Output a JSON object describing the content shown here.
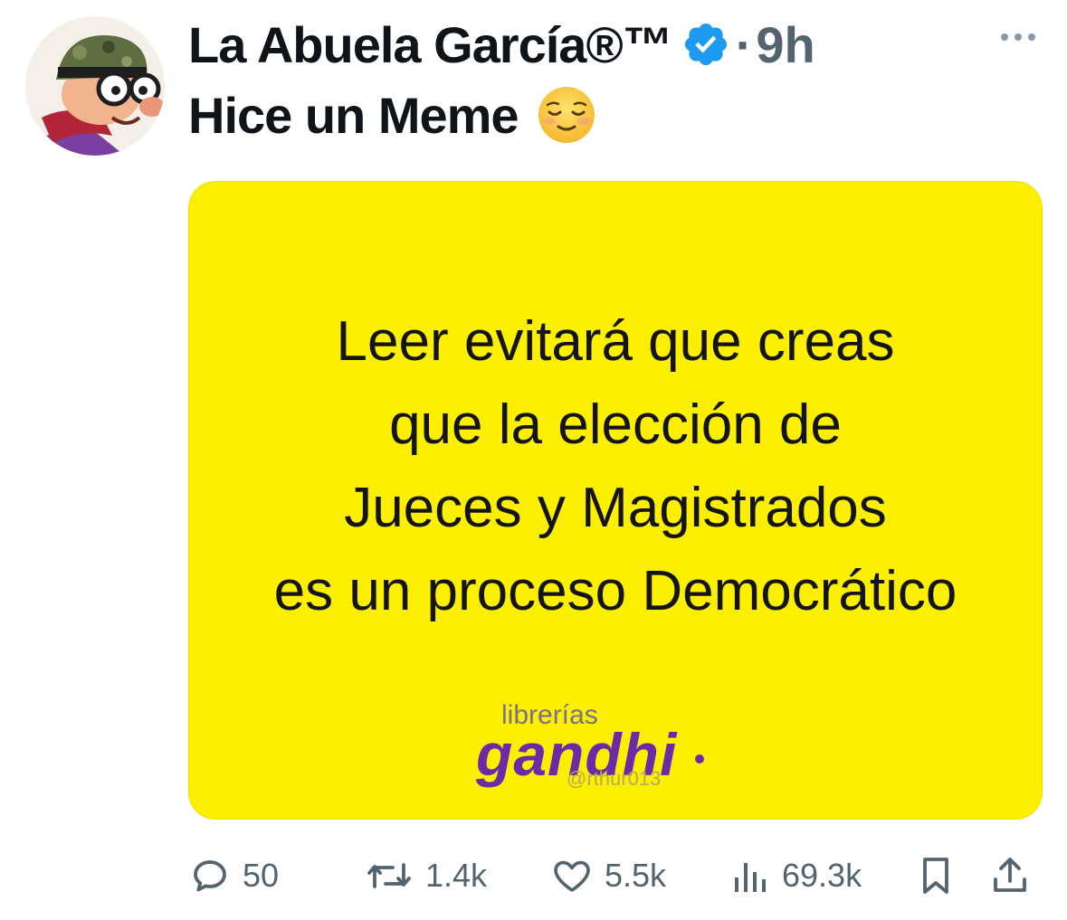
{
  "tweet": {
    "display_name": "La Abuela García®™",
    "separator": "·",
    "time": "9h",
    "text": "Hice un Meme",
    "emoji": "relieved-face-emoji",
    "verified_color": "#1d9bf0"
  },
  "media": {
    "background": "#fdef00",
    "lines": [
      "Leer evitará que creas",
      "que la elección de",
      "Jueces y Magistrados",
      "es un proceso Democrático"
    ],
    "logo_small": "librerías",
    "logo_big": "gandhi",
    "watermark": "@rthur013"
  },
  "actions": {
    "replies": "50",
    "retweets": "1.4k",
    "likes": "5.5k",
    "views": "69.3k"
  }
}
